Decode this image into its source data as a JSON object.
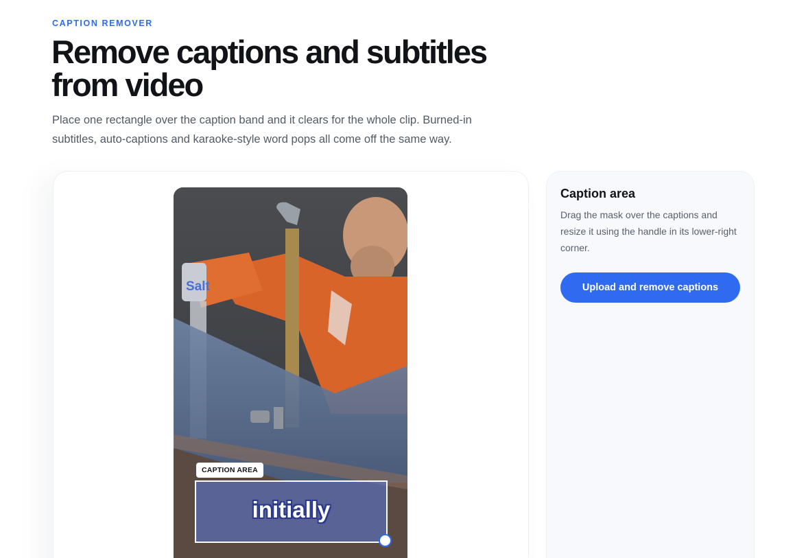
{
  "header": {
    "eyebrow": "CAPTION REMOVER",
    "title": "Remove captions and subtitles from video",
    "lede": "Place one rectangle over the caption band and it clears for the whole clip. Burned-in subtitles, auto-captions and karaoke-style word pops all come off the same way."
  },
  "preview": {
    "mask_label": "CAPTION AREA",
    "caption_text": "initially",
    "salt_label": "Salt"
  },
  "sidebar": {
    "title": "Caption area",
    "description": "Drag the mask over the captions and resize it using the handle in its lower-right corner.",
    "button_label": "Upload and remove captions"
  },
  "colors": {
    "accent": "#2f6bf0",
    "mask_fill": "#5a78dc"
  }
}
